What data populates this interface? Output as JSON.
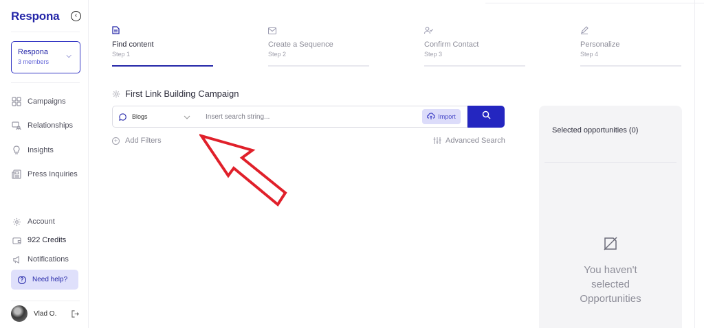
{
  "brand": {
    "logo": "Respona",
    "accent": "#2426a8"
  },
  "workspace": {
    "name": "Respona",
    "members": "3 members"
  },
  "nav": {
    "main": [
      {
        "label": "Campaigns",
        "icon": "grid-icon"
      },
      {
        "label": "Relationships",
        "icon": "chat-people-icon"
      },
      {
        "label": "Insights",
        "icon": "lightbulb-icon"
      },
      {
        "label": "Press Inquiries",
        "icon": "newspaper-icon"
      }
    ],
    "bottom": [
      {
        "label": "Account",
        "icon": "gear-icon"
      },
      {
        "label": "922 Credits",
        "icon": "wallet-icon"
      },
      {
        "label": "Notifications",
        "icon": "megaphone-icon"
      }
    ],
    "help": "Need help?"
  },
  "user": {
    "name": "Vlad O."
  },
  "steps": [
    {
      "title": "Find content",
      "num": "Step 1",
      "icon": "document-icon",
      "active": true
    },
    {
      "title": "Create a Sequence",
      "num": "Step 2",
      "icon": "mail-icon",
      "active": false
    },
    {
      "title": "Confirm Contact",
      "num": "Step 3",
      "icon": "user-check-icon",
      "active": false
    },
    {
      "title": "Personalize",
      "num": "Step 4",
      "icon": "pencil-icon",
      "active": false
    }
  ],
  "campaign": {
    "title": "First Link Building Campaign"
  },
  "search": {
    "type": "Blogs",
    "placeholder": "Insert search string...",
    "import": "Import",
    "add_filters": "Add Filters",
    "advanced": "Advanced Search"
  },
  "panel": {
    "header": "Selected opportunities (0)",
    "empty_line1": "You haven't",
    "empty_line2": "selected",
    "empty_line3": "Opportunities"
  }
}
